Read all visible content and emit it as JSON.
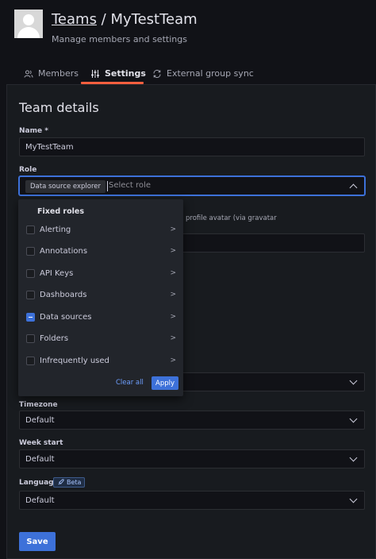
{
  "header": {
    "breadcrumb_link": "Teams",
    "separator": " / ",
    "team_name": "MyTestTeam",
    "subtitle": "Manage members and settings"
  },
  "tabs": [
    {
      "label": "Members",
      "icon": "users-icon",
      "active": false
    },
    {
      "label": "Settings",
      "icon": "sliders-icon",
      "active": true
    },
    {
      "label": "External group sync",
      "icon": "sync-icon",
      "active": false
    }
  ],
  "form": {
    "section_title": "Team details",
    "name_label": "Name *",
    "name_value": "MyTestTeam",
    "role_label": "Role",
    "role_selected_chip": "Data source explorer",
    "role_placeholder": "Select role",
    "helper_text": "profile avatar (via gravatar",
    "timezone_label": "Timezone",
    "timezone_value": "Default",
    "week_start_label": "Week start",
    "week_start_value": "Default",
    "language_label": "Language",
    "language_badge": "Beta",
    "language_value": "Default",
    "save_label": "Save"
  },
  "role_dropdown": {
    "header": "Fixed roles",
    "items": [
      {
        "label": "Alerting",
        "state": "unchecked"
      },
      {
        "label": "Annotations",
        "state": "unchecked"
      },
      {
        "label": "API Keys",
        "state": "unchecked"
      },
      {
        "label": "Dashboards",
        "state": "unchecked"
      },
      {
        "label": "Data sources",
        "state": "partial"
      },
      {
        "label": "Folders",
        "state": "unchecked"
      },
      {
        "label": "Infrequently used",
        "state": "unchecked"
      }
    ],
    "submenu_arrow": ">",
    "clear_label": "Clear all",
    "apply_label": "Apply"
  },
  "colors": {
    "background": "#111217",
    "panel": "#181b1f",
    "accent": "#3d71d9",
    "active_tab_underline": "#f55f3e"
  }
}
